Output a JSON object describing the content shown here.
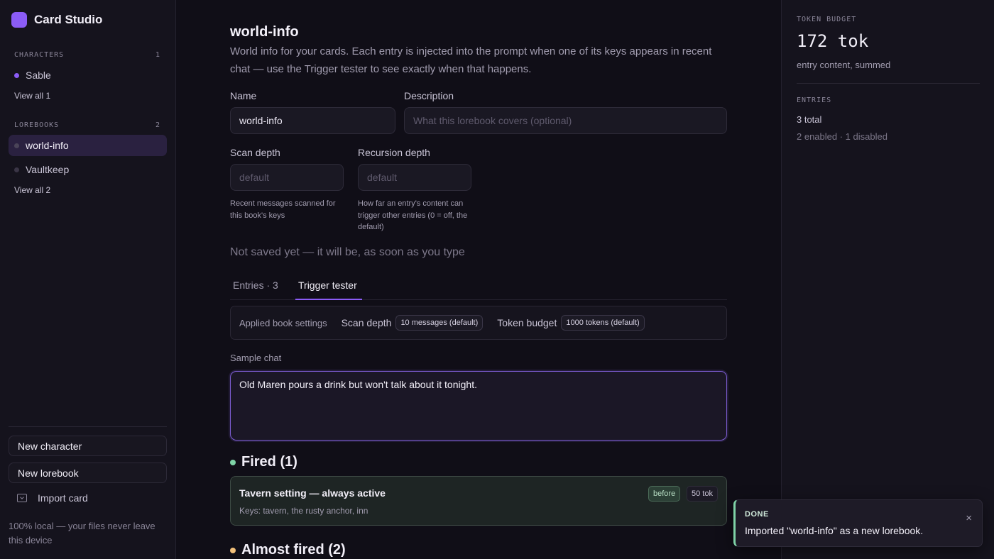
{
  "app": {
    "name": "Card Studio",
    "accent": "#8b5cf6"
  },
  "sidebar": {
    "characters": {
      "heading": "CHARACTERS",
      "count": "1",
      "items": [
        {
          "label": "Sable",
          "dot_color": "#8b5cf6"
        }
      ],
      "view_all": "View all 1"
    },
    "lorebooks": {
      "heading": "LOREBOOKS",
      "count": "2",
      "items": [
        {
          "label": "world-info",
          "active": true
        },
        {
          "label": "Vaultkeep"
        }
      ],
      "view_all": "View all 2"
    },
    "new_character": "New character",
    "new_lorebook": "New lorebook",
    "import_card": "Import card",
    "footer": "100% local — your files never leave this device"
  },
  "main": {
    "title": "world-info",
    "description": "World info for your cards. Each entry is injected into the prompt when one of its keys appears in recent chat — use the Trigger tester to see exactly when that happens.",
    "name_label": "Name",
    "name_value": "world-info",
    "description_label": "Description",
    "description_placeholder": "What this lorebook covers (optional)",
    "scan_depth_label": "Scan depth",
    "scan_depth_placeholder": "default",
    "scan_depth_help": "Recent messages scanned for this book's keys",
    "recursion_depth_label": "Recursion depth",
    "recursion_depth_placeholder": "default",
    "recursion_depth_help": "How far an entry's content can trigger other entries (0 = off, the default)",
    "save_status": "Not saved yet — it will be, as soon as you type",
    "tabs": [
      {
        "label": "Entries · 3"
      },
      {
        "label": "Trigger tester",
        "active": true
      }
    ],
    "applied_settings": {
      "label": "Applied book settings",
      "scan_depth_key": "Scan depth",
      "scan_depth_value": "10 messages (default)",
      "token_budget_key": "Token budget",
      "token_budget_value": "1000 tokens (default)"
    },
    "sample_chat_label": "Sample chat",
    "sample_chat_value": "Old Maren pours a drink but won't talk about it tonight.",
    "fired": {
      "heading": "Fired (1)",
      "dot_color": "#7fd3a7",
      "entries": [
        {
          "title": "Tavern setting — always active",
          "keys": "Keys: tavern, the rusty anchor, inn",
          "position": "before",
          "tokens": "50 tok"
        }
      ]
    },
    "almost_fired": {
      "heading": "Almost fired (2)",
      "dot_color": "#f2c07a"
    }
  },
  "right_panel": {
    "token_budget_heading": "TOKEN BUDGET",
    "token_total": "172 tok",
    "token_sub": "entry content, summed",
    "entries_heading": "ENTRIES",
    "entries_total": "3 total",
    "entries_breakdown": "2 enabled · 1 disabled"
  },
  "toast": {
    "heading": "DONE",
    "message": "Imported \"world-info\" as a new lorebook.",
    "close": "×",
    "accent": "#7fd3a7"
  }
}
